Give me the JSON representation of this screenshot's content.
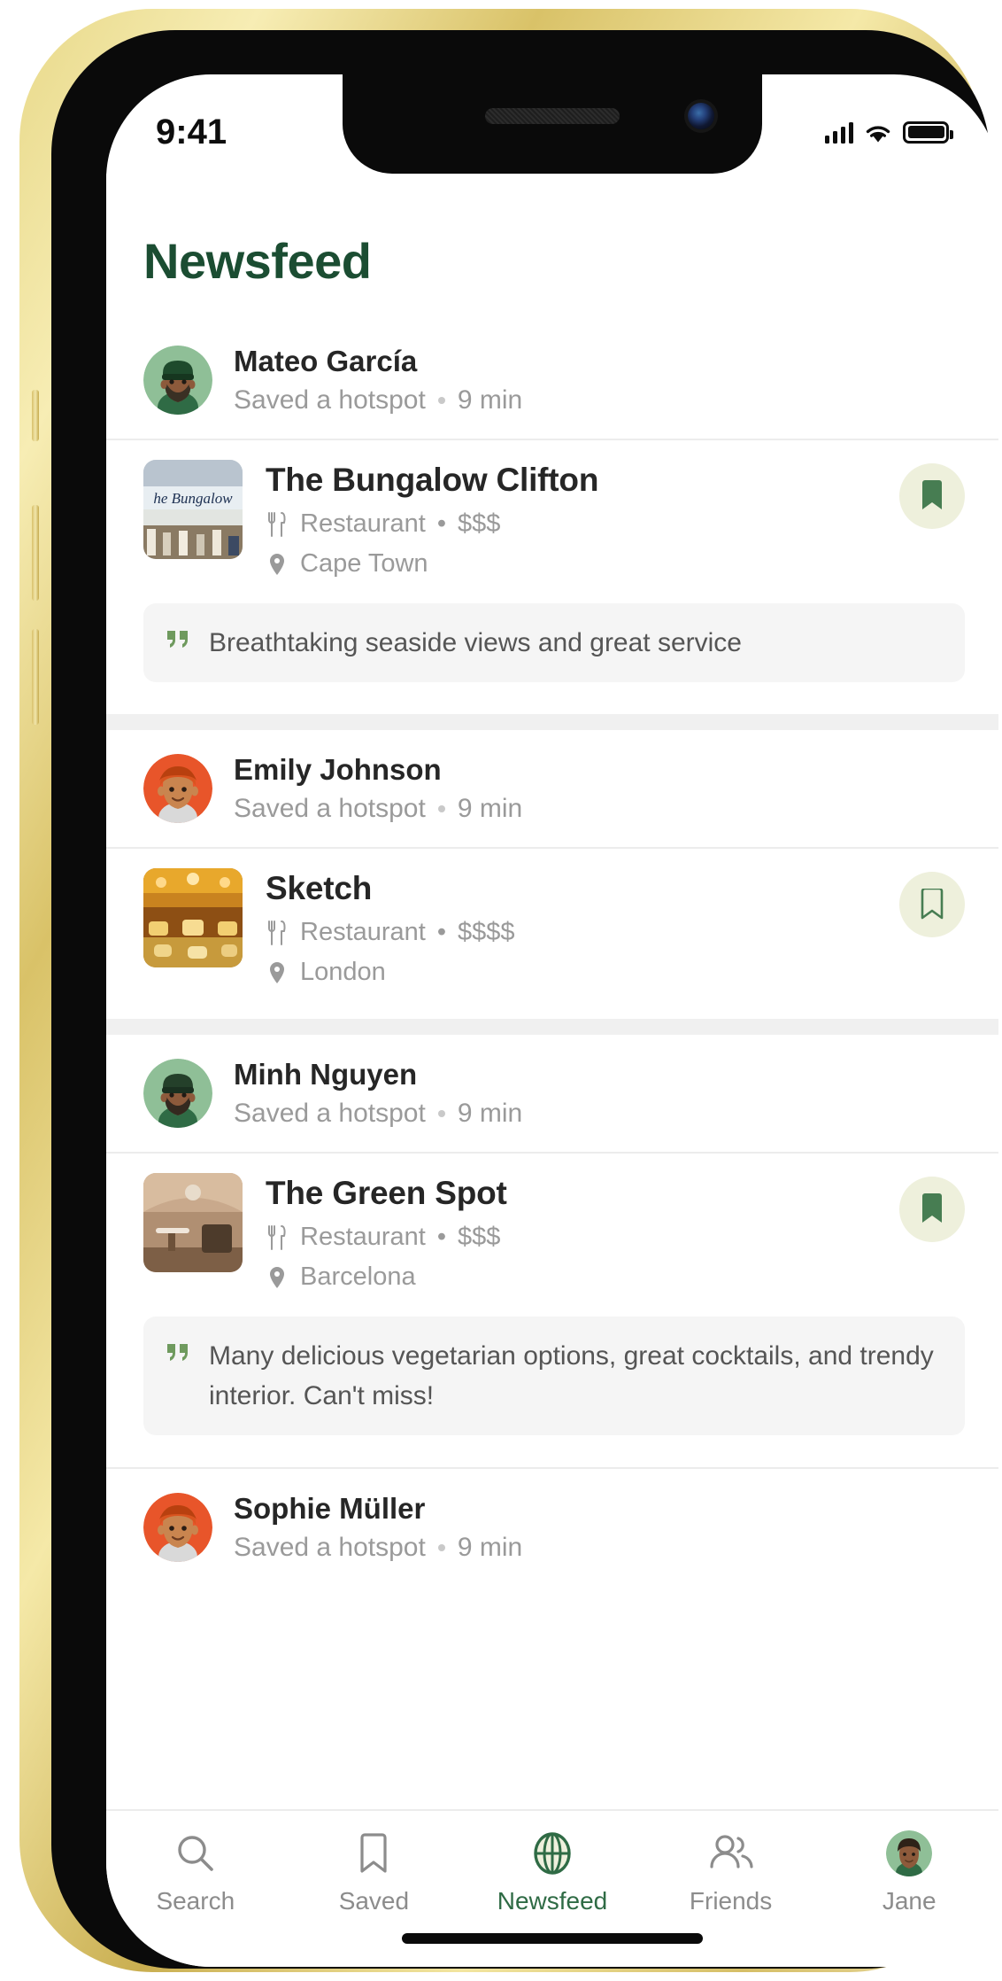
{
  "statusbar": {
    "time": "9:41",
    "signal_icon": "cellular-signal-icon",
    "wifi_icon": "wifi-icon",
    "battery_icon": "battery-icon"
  },
  "header": {
    "title": "Newsfeed",
    "title_color": "#1b4d32"
  },
  "feed": [
    {
      "user": {
        "name": "Mateo García",
        "action": "Saved a hotspot",
        "time": "9 min",
        "avatar": "avatar-mateo"
      },
      "hotspot": {
        "name": "The Bungalow Clifton",
        "category": "Restaurant",
        "price": "$$$",
        "location": "Cape Town",
        "thumb": "thumb-bungalow",
        "saved": true,
        "save_icon": "bookmark-filled-icon",
        "category_icon": "cutlery-icon",
        "location_icon": "map-pin-icon"
      },
      "quote": "Breathtaking seaside views and great service"
    },
    {
      "user": {
        "name": "Emily Johnson",
        "action": "Saved a hotspot",
        "time": "9 min",
        "avatar": "avatar-emily"
      },
      "hotspot": {
        "name": "Sketch",
        "category": "Restaurant",
        "price": "$$$$",
        "location": "London",
        "thumb": "thumb-sketch",
        "saved": false,
        "save_icon": "bookmark-outline-icon",
        "category_icon": "cutlery-icon",
        "location_icon": "map-pin-icon"
      },
      "quote": null
    },
    {
      "user": {
        "name": "Minh Nguyen",
        "action": "Saved a hotspot",
        "time": "9 min",
        "avatar": "avatar-minh"
      },
      "hotspot": {
        "name": "The Green Spot",
        "category": "Restaurant",
        "price": "$$$",
        "location": "Barcelona",
        "thumb": "thumb-greenspot",
        "saved": true,
        "save_icon": "bookmark-filled-icon",
        "category_icon": "cutlery-icon",
        "location_icon": "map-pin-icon"
      },
      "quote": "Many delicious vegetarian options, great cocktails, and trendy interior. Can't miss!"
    },
    {
      "user": {
        "name": "Sophie Müller",
        "action": "Saved a hotspot",
        "time": "9 min",
        "avatar": "avatar-sophie"
      },
      "hotspot": null,
      "quote": null
    }
  ],
  "tabbar": {
    "items": [
      {
        "label": "Search",
        "icon": "search-icon",
        "active": false
      },
      {
        "label": "Saved",
        "icon": "bookmark-icon",
        "active": false
      },
      {
        "label": "Newsfeed",
        "icon": "globe-icon",
        "active": true
      },
      {
        "label": "Friends",
        "icon": "people-icon",
        "active": false
      },
      {
        "label": "Jane",
        "icon": "avatar-jane",
        "active": false
      }
    ],
    "active_color": "#2f6b45",
    "inactive_color": "#8c8c8c"
  },
  "colors": {
    "brand_green": "#1b4d32",
    "accent_green": "#477d52",
    "save_pill_bg": "#eef0dc",
    "quote_bg": "#f5f5f5",
    "divider": "#ececec"
  }
}
